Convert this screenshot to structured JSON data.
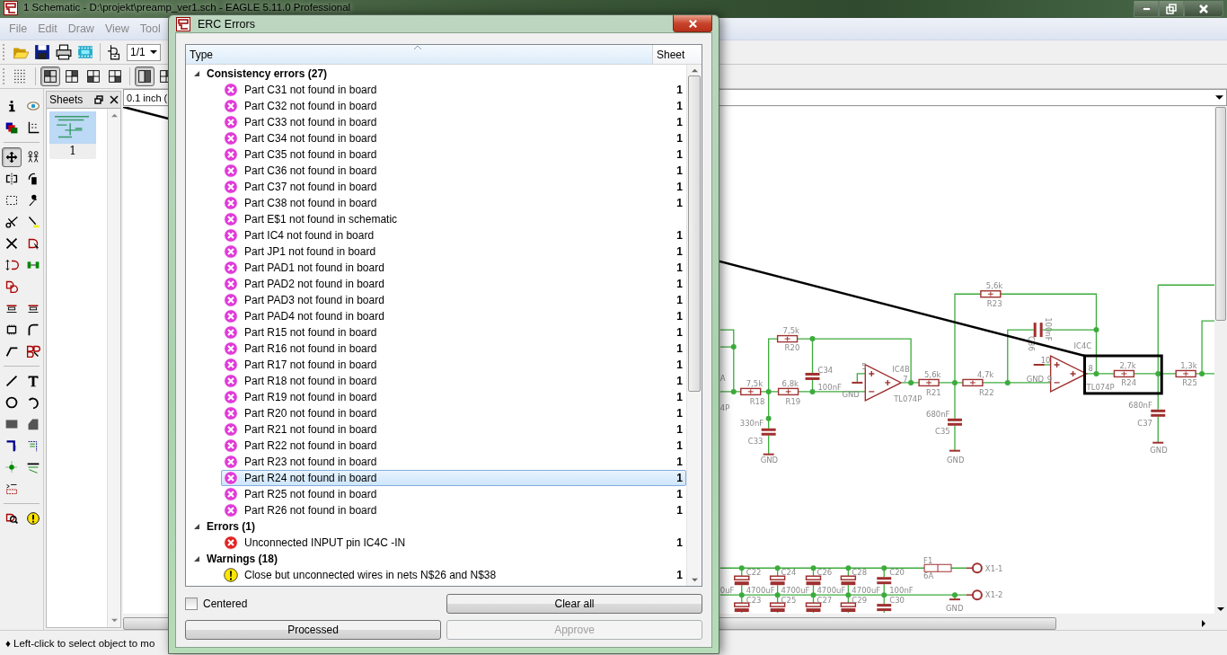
{
  "window": {
    "title": "1 Schematic - D:\\projekt\\preamp_ver1.sch - EAGLE 5.11.0 Professional"
  },
  "menu": [
    "File",
    "Edit",
    "Draw",
    "View",
    "Tool"
  ],
  "toolbar": {
    "sheet_combo": "1/1"
  },
  "view_buttons": [
    {
      "selected": true
    },
    {
      "selected": false
    },
    {
      "selected": false
    },
    {
      "selected": false
    },
    {
      "selected": true
    },
    {
      "selected": false
    }
  ],
  "tool_palette": [
    {
      "selected": false
    },
    {
      "selected": false
    },
    {
      "selected": false
    },
    {
      "selected": false
    },
    {
      "selected": true
    },
    {
      "selected": false
    },
    {
      "selected": false
    },
    {
      "selected": false
    },
    {
      "selected": false
    },
    {
      "selected": false
    },
    {
      "selected": false
    },
    {
      "selected": false
    },
    {
      "selected": false
    },
    {
      "selected": false
    },
    {
      "selected": false
    },
    {
      "selected": false
    },
    {
      "selected": false
    },
    {
      "selected": false
    },
    {
      "selected": false
    },
    {
      "selected": false
    },
    {
      "selected": false
    },
    {
      "selected": false
    },
    {
      "selected": false
    },
    {
      "selected": false
    },
    {
      "selected": false
    },
    {
      "selected": false
    },
    {
      "selected": false
    },
    {
      "selected": false
    },
    {
      "selected": false
    },
    {
      "selected": false
    },
    {
      "selected": false
    },
    {
      "selected": false
    },
    {
      "selected": false
    },
    {
      "selected": false
    },
    {
      "selected": false
    },
    {
      "selected": false
    }
  ],
  "sheets": {
    "title": "Sheets",
    "items": [
      {
        "label": "1",
        "selected": true
      }
    ]
  },
  "grid_field": "0.1 inch (",
  "schematic": {
    "labels": [
      "5,6k",
      "R23",
      "7,5k",
      "R20",
      "C34",
      "100nF",
      "IC4B",
      "7",
      "5",
      "GND",
      "7,5k",
      "R18",
      "6,8k",
      "R19",
      "TL074P",
      "5,6k",
      "R21",
      "4,7k",
      "R22",
      "330nF",
      "C33",
      "GND",
      "680nF",
      "C35",
      "GND",
      "C36",
      "100nF",
      "10",
      "GND",
      "9",
      "IC4C",
      "8",
      "TL074P",
      "2,7k",
      "R24",
      "1,3k",
      "R25",
      "680nF",
      "C37",
      "GND",
      "A",
      "4P",
      "C22",
      "C24",
      "C26",
      "C28",
      "C20",
      "0uF",
      "4700uF",
      "4700uF",
      "4700uF",
      "4700uF",
      "100nF",
      "C23",
      "C25",
      "C27",
      "C29",
      "C30",
      "F1",
      "6A",
      "X1-1",
      "X1-2",
      "GND"
    ]
  },
  "status_bar": "♦ Left-click to select object to mo",
  "erc": {
    "title": "ERC Errors",
    "columns": [
      "Type",
      "Sheet"
    ],
    "groups": [
      {
        "label": "Consistency errors (27)",
        "expanded": true,
        "items": [
          {
            "kind": "consistency",
            "text": "Part C31 not found in board",
            "sheet": "1",
            "selected": false
          },
          {
            "kind": "consistency",
            "text": "Part C32 not found in board",
            "sheet": "1",
            "selected": false
          },
          {
            "kind": "consistency",
            "text": "Part C33 not found in board",
            "sheet": "1",
            "selected": false
          },
          {
            "kind": "consistency",
            "text": "Part C34 not found in board",
            "sheet": "1",
            "selected": false
          },
          {
            "kind": "consistency",
            "text": "Part C35 not found in board",
            "sheet": "1",
            "selected": false
          },
          {
            "kind": "consistency",
            "text": "Part C36 not found in board",
            "sheet": "1",
            "selected": false
          },
          {
            "kind": "consistency",
            "text": "Part C37 not found in board",
            "sheet": "1",
            "selected": false
          },
          {
            "kind": "consistency",
            "text": "Part C38 not found in board",
            "sheet": "1",
            "selected": false
          },
          {
            "kind": "consistency",
            "text": "Part E$1 not found in schematic",
            "selected": false
          },
          {
            "kind": "consistency",
            "text": "Part IC4 not found in board",
            "sheet": "1",
            "selected": false
          },
          {
            "kind": "consistency",
            "text": "Part JP1 not found in board",
            "sheet": "1",
            "selected": false
          },
          {
            "kind": "consistency",
            "text": "Part PAD1 not found in board",
            "sheet": "1",
            "selected": false
          },
          {
            "kind": "consistency",
            "text": "Part PAD2 not found in board",
            "sheet": "1",
            "selected": false
          },
          {
            "kind": "consistency",
            "text": "Part PAD3 not found in board",
            "sheet": "1",
            "selected": false
          },
          {
            "kind": "consistency",
            "text": "Part PAD4 not found in board",
            "sheet": "1",
            "selected": false
          },
          {
            "kind": "consistency",
            "text": "Part R15 not found in board",
            "sheet": "1",
            "selected": false
          },
          {
            "kind": "consistency",
            "text": "Part R16 not found in board",
            "sheet": "1",
            "selected": false
          },
          {
            "kind": "consistency",
            "text": "Part R17 not found in board",
            "sheet": "1",
            "selected": false
          },
          {
            "kind": "consistency",
            "text": "Part R18 not found in board",
            "sheet": "1",
            "selected": false
          },
          {
            "kind": "consistency",
            "text": "Part R19 not found in board",
            "sheet": "1",
            "selected": false
          },
          {
            "kind": "consistency",
            "text": "Part R20 not found in board",
            "sheet": "1",
            "selected": false
          },
          {
            "kind": "consistency",
            "text": "Part R21 not found in board",
            "sheet": "1",
            "selected": false
          },
          {
            "kind": "consistency",
            "text": "Part R22 not found in board",
            "sheet": "1",
            "selected": false
          },
          {
            "kind": "consistency",
            "text": "Part R23 not found in board",
            "sheet": "1",
            "selected": false
          },
          {
            "kind": "consistency",
            "text": "Part R24 not found in board",
            "sheet": "1",
            "selected": true
          },
          {
            "kind": "consistency",
            "text": "Part R25 not found in board",
            "sheet": "1",
            "selected": false
          },
          {
            "kind": "consistency",
            "text": "Part R26 not found in board",
            "sheet": "1",
            "selected": false
          }
        ]
      },
      {
        "label": "Errors (1)",
        "expanded": true,
        "items": [
          {
            "kind": "error",
            "text": "Unconnected INPUT pin IC4C -IN",
            "sheet": "1",
            "selected": false
          }
        ]
      },
      {
        "label": "Warnings (18)",
        "expanded": true,
        "items": [
          {
            "kind": "warning",
            "text": "Close but unconnected wires in nets N$26 and N$38",
            "sheet": "1",
            "selected": false
          }
        ]
      }
    ],
    "centered": {
      "label": "Centered",
      "checked": false
    },
    "buttons": [
      {
        "label": "Clear all",
        "disabled": false
      },
      {
        "label": "Processed",
        "disabled": false
      },
      {
        "label": "Approve",
        "disabled": true
      }
    ]
  }
}
